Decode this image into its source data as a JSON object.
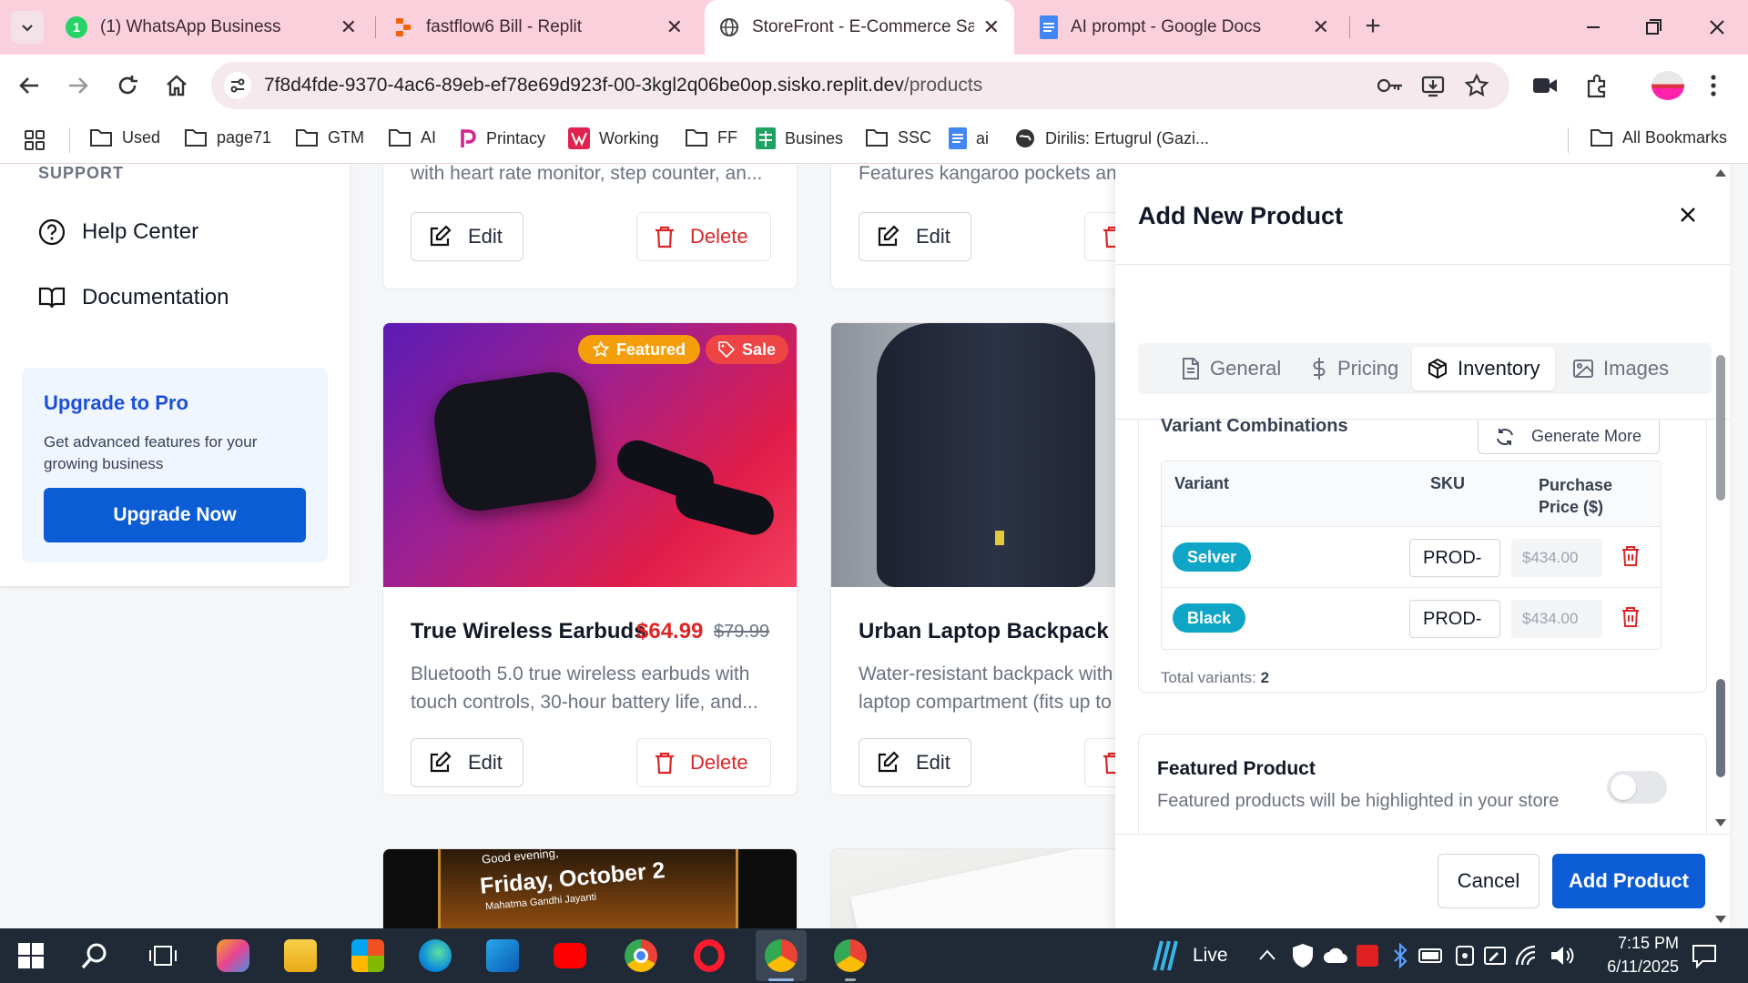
{
  "browser": {
    "tabs": [
      {
        "title": "(1) WhatsApp Business",
        "active": false
      },
      {
        "title": "fastflow6 Bill - Replit",
        "active": false
      },
      {
        "title": "StoreFront - E-Commerce SaaS",
        "active": true
      },
      {
        "title": "AI prompt - Google Docs",
        "active": false
      }
    ],
    "url_host": "7f8d4fde-9370-4ac6-89eb-ef78e69d923f-00-3kgl2q06be0op.sisko.replit.dev",
    "url_path": "/products",
    "bookmarks": [
      "Used",
      "page71",
      "GTM",
      "AI",
      "Printacy",
      "Working",
      "FF",
      "Busines",
      "SSC",
      "ai",
      "Dirilis: Ertugrul (Gazi...",
      "All Bookmarks"
    ]
  },
  "sidebar": {
    "section_label": "SUPPORT",
    "items": [
      "Help Center",
      "Documentation"
    ],
    "upgrade": {
      "title": "Upgrade to Pro",
      "text": "Get advanced features for your growing business",
      "button": "Upgrade Now"
    }
  },
  "products": {
    "top_row": [
      {
        "desc": "with heart rate monitor, step counter, an..."
      },
      {
        "desc": "Features kangaroo pockets and"
      }
    ],
    "middle_row": [
      {
        "badges": [
          "Featured",
          "Sale"
        ],
        "name": "True Wireless Earbuds",
        "price": "$64.99",
        "old_price": "$79.99",
        "desc_line1": "Bluetooth 5.0 true wireless earbuds with",
        "desc_line2": "touch controls, 30-hour battery life, and..."
      },
      {
        "name": "Urban Laptop Backpack",
        "desc_line1": "Water-resistant backpack with",
        "desc_line2": "laptop compartment (fits up to"
      }
    ],
    "edit_label": "Edit",
    "delete_label": "Delete",
    "phone_text": {
      "greeting": "Good evening,",
      "date": "Friday, October 2",
      "sub": "Mahatma Gandhi Jayanti"
    }
  },
  "modal": {
    "title": "Add New Product",
    "tabs": [
      "General",
      "Pricing",
      "Inventory",
      "Images"
    ],
    "active_tab": "Inventory",
    "variants_title": "Variant Combinations",
    "generate_label": "Generate More",
    "table_headers": [
      "Variant",
      "SKU",
      "Purchase Price ($)"
    ],
    "purchase_header_line1": "Purchase",
    "purchase_header_line2": "Price ($)",
    "rows": [
      {
        "variant": "Selver",
        "sku": "PROD-",
        "price": "$434.00"
      },
      {
        "variant": "Black",
        "sku": "PROD-",
        "price": "$434.00"
      }
    ],
    "total_label": "Total variants:",
    "total_count": "2",
    "featured": {
      "title": "Featured Product",
      "desc": "Featured products will be highlighted in your store",
      "enabled": false
    },
    "cancel_label": "Cancel",
    "submit_label": "Add Product"
  },
  "taskbar": {
    "weather": "Live",
    "time": "7:15 PM",
    "date": "6/11/2025"
  },
  "colors": {
    "primary": "#0b5cd5",
    "danger": "#dc2626",
    "featured_badge": "#f59e0b",
    "sale_badge": "#ef4444",
    "variant_pill": "#0ea5c6",
    "tab_strip": "#fad0dd"
  }
}
